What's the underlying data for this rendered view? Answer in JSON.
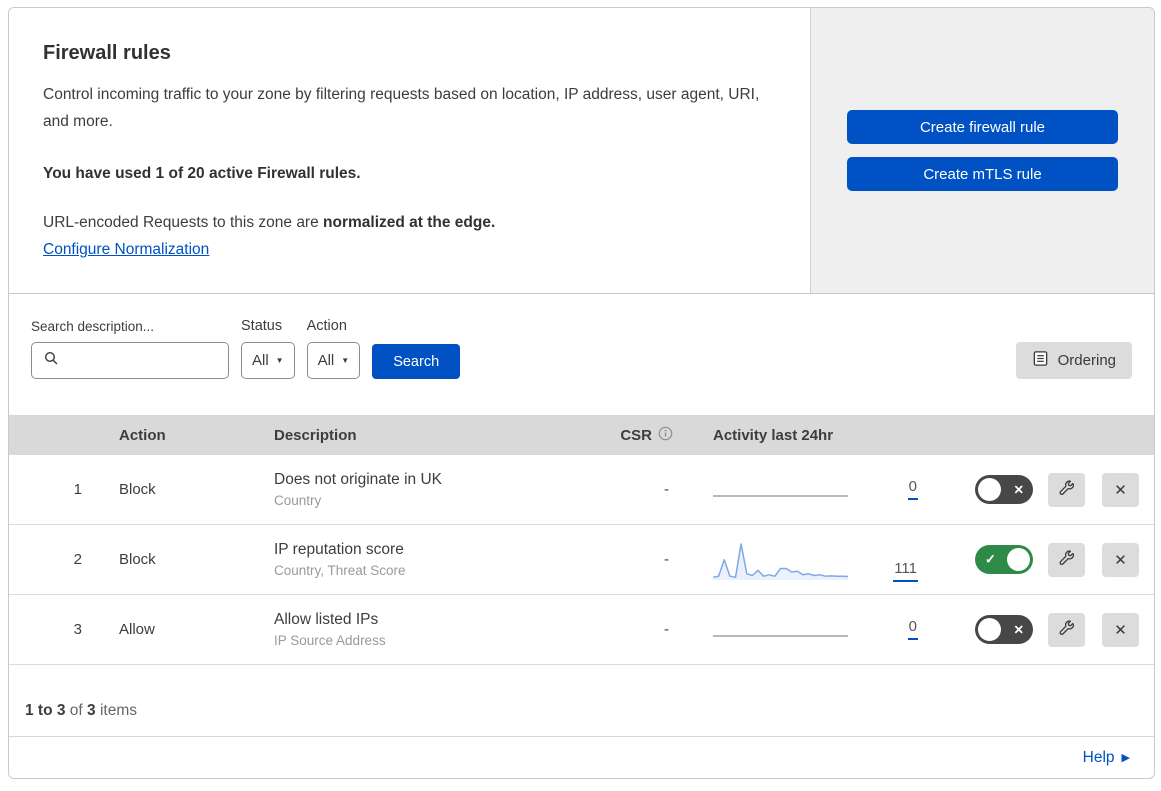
{
  "header": {
    "title": "Firewall rules",
    "description": "Control incoming traffic to your zone by filtering requests based on location, IP address, user agent, URI, and more.",
    "usage_line": "You have used 1 of 20 active Firewall rules.",
    "normalization_text": "URL-encoded Requests to this zone are ",
    "normalization_bold": "normalized at the edge.",
    "normalization_link": "Configure Normalization",
    "create_firewall_button": "Create firewall rule",
    "create_mtls_button": "Create mTLS rule"
  },
  "filters": {
    "search_label": "Search description...",
    "status_label": "Status",
    "status_value": "All",
    "action_label": "Action",
    "action_value": "All",
    "search_button": "Search",
    "ordering_button": "Ordering"
  },
  "table": {
    "columns": {
      "action": "Action",
      "description": "Description",
      "csr": "CSR",
      "activity": "Activity last 24hr"
    },
    "rows": [
      {
        "number": "1",
        "action": "Block",
        "description": "Does not originate in UK",
        "criteria": "Country",
        "csr": "-",
        "activity_count": "0",
        "enabled": false
      },
      {
        "number": "2",
        "action": "Block",
        "description": "IP reputation score",
        "criteria": "Country, Threat Score",
        "csr": "-",
        "activity_count": "111",
        "enabled": true
      },
      {
        "number": "3",
        "action": "Allow",
        "description": "Allow listed IPs",
        "criteria": "IP Source Address",
        "csr": "-",
        "activity_count": "0",
        "enabled": false
      }
    ]
  },
  "footer": {
    "range": "1 to 3",
    "of_text": " of ",
    "total": "3",
    "items_text": " items",
    "help_link": "Help"
  },
  "colors": {
    "accent_blue": "#0051c3",
    "toggle_on_green": "#2e8b47",
    "toggle_off_gray": "#474747",
    "sparkline_blue": "#7fa9e6",
    "table_header_gray": "#d9d9d9",
    "panel_gray": "#efefef"
  },
  "chart_data": {
    "type": "line",
    "title": "Activity last 24hr sparkline (rule 2)",
    "points": [
      5,
      8,
      55,
      8,
      5,
      100,
      15,
      10,
      25,
      8,
      12,
      8,
      30,
      30,
      20,
      22,
      12,
      15,
      10,
      12,
      8,
      9,
      8,
      8,
      7
    ],
    "total_requests": 111,
    "x_range_hours": 24,
    "ylabel": "",
    "xlabel": "",
    "grid": false,
    "legend": false
  }
}
